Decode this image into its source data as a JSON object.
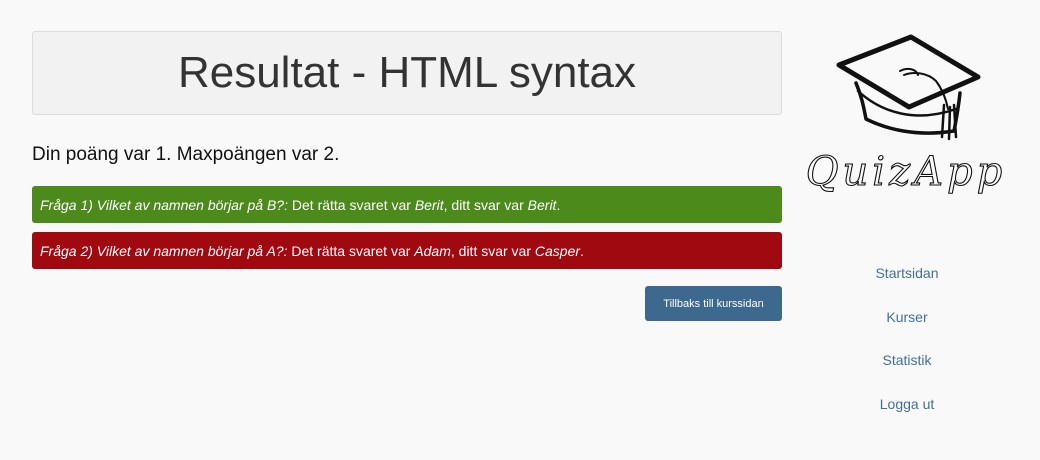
{
  "header": {
    "title": "Resultat - HTML syntax"
  },
  "score_text": "Din poäng var 1. Maxpoängen var 2.",
  "answers": [
    {
      "question": "Fråga 1) Vilket av namnen börjar på B?:",
      "correct_prefix": " Det rätta svaret var ",
      "correct_answer": "Berit",
      "user_prefix": ", ditt svar var ",
      "user_answer": "Berit",
      "suffix": ".",
      "status": "correct",
      "color": "#4b8a1b"
    },
    {
      "question": "Fråga 2) Vilket av namnen börjar på A?:",
      "correct_prefix": " Det rätta svaret var ",
      "correct_answer": "Adam",
      "user_prefix": ", ditt svar var ",
      "user_answer": "Casper",
      "suffix": ".",
      "status": "wrong",
      "color": "#a00910"
    }
  ],
  "back_button_label": "Tillbaks till kurssidan",
  "logo": {
    "text": "QuizApp",
    "icon": "graduation-cap-icon"
  },
  "nav": {
    "items": [
      {
        "label": "Startsidan"
      },
      {
        "label": "Kurser"
      },
      {
        "label": "Statistik"
      },
      {
        "label": "Logga ut"
      }
    ]
  },
  "colors": {
    "accent": "#3d698f",
    "link": "#41709e",
    "correct": "#4b8a1b",
    "wrong": "#a00910"
  }
}
